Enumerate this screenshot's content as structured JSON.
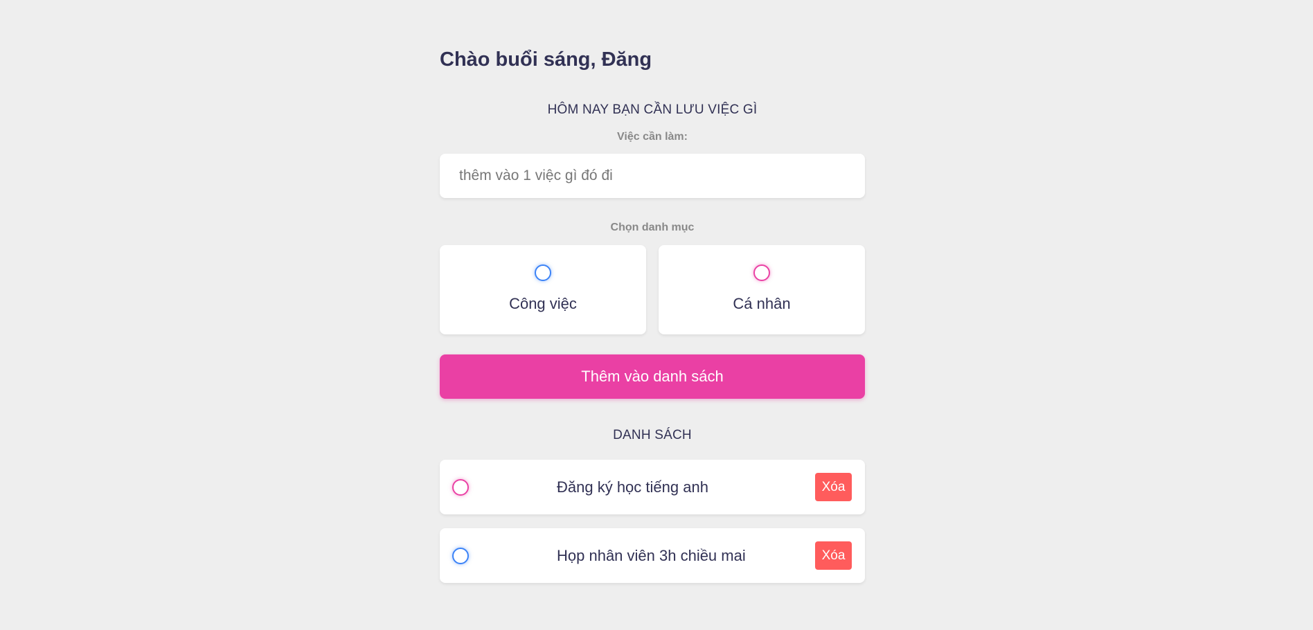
{
  "greeting": "Chào buổi sáng, Đăng",
  "form": {
    "title": "HÔM NAY BẠN CẦN LƯU VIỆC GÌ",
    "task_label": "Việc cần làm:",
    "task_value": "",
    "task_placeholder": "thêm vào 1 việc gì đó đi",
    "category_label": "Chọn danh mục",
    "categories": [
      {
        "label": "Công việc",
        "color": "#3a82f7",
        "selected": false
      },
      {
        "label": "Cá nhân",
        "color": "#ea40a4",
        "selected": false
      }
    ],
    "add_button_label": "Thêm vào danh sách"
  },
  "list": {
    "title": "DANH SÁCH",
    "items": [
      {
        "text": "Đăng ký học tiếng anh",
        "category_color": "#ea40a4",
        "done": false,
        "delete_label": "Xóa"
      },
      {
        "text": "Họp nhân viên 3h chiều mai",
        "category_color": "#3a82f7",
        "done": false,
        "delete_label": "Xóa"
      }
    ]
  },
  "colors": {
    "background": "#eeeeee",
    "accent": "#ea40a4",
    "business": "#3a82f7",
    "personal": "#ea40a4",
    "delete": "#ff5c5c",
    "text": "#313154"
  }
}
